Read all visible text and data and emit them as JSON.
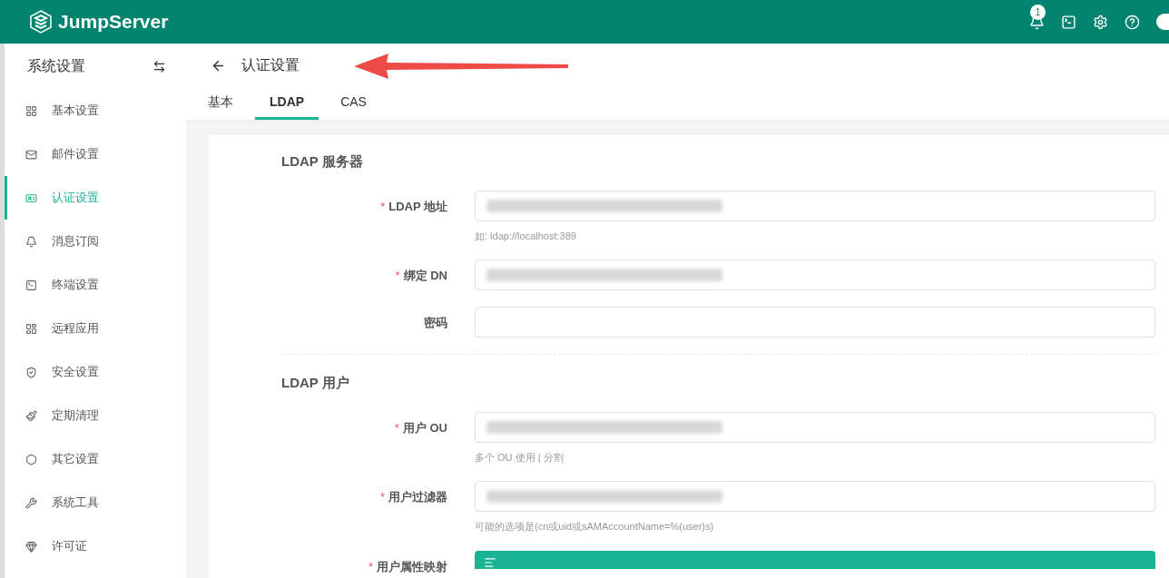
{
  "brand": {
    "name": "JumpServer"
  },
  "header": {
    "notification_count": "1"
  },
  "sidebar": {
    "title": "系统设置",
    "items": [
      {
        "label": "基本设置",
        "selected": false
      },
      {
        "label": "邮件设置",
        "selected": false
      },
      {
        "label": "认证设置",
        "selected": true
      },
      {
        "label": "消息订阅",
        "selected": false
      },
      {
        "label": "终端设置",
        "selected": false
      },
      {
        "label": "远程应用",
        "selected": false
      },
      {
        "label": "安全设置",
        "selected": false
      },
      {
        "label": "定期清理",
        "selected": false
      },
      {
        "label": "其它设置",
        "selected": false
      },
      {
        "label": "系统工具",
        "selected": false
      },
      {
        "label": "许可证",
        "selected": false
      }
    ]
  },
  "page": {
    "title": "认证设置"
  },
  "tabs": [
    {
      "label": "基本",
      "selected": false
    },
    {
      "label": "LDAP",
      "selected": true
    },
    {
      "label": "CAS",
      "selected": false
    }
  ],
  "sections": [
    {
      "title": "LDAP 服务器",
      "fields": [
        {
          "label": "LDAP 地址",
          "required_mark": "*",
          "redacted": true,
          "help": "如: ldap://localhost:389"
        },
        {
          "label": "绑定 DN",
          "required_mark": "*",
          "redacted": true
        },
        {
          "label": "密码",
          "redacted": false
        }
      ]
    },
    {
      "title": "LDAP 用户",
      "fields": [
        {
          "label": "用户 OU",
          "required_mark": "*",
          "redacted": true,
          "help": "多个 OU 使用 | 分割"
        },
        {
          "label": "用户过滤器",
          "required_mark": "*",
          "redacted": true,
          "help": "可能的选项是(cn或uid或sAMAccountName=%(user)s)"
        },
        {
          "label": "用户属性映射",
          "required_mark": "*",
          "kind": "editor"
        }
      ]
    }
  ]
}
